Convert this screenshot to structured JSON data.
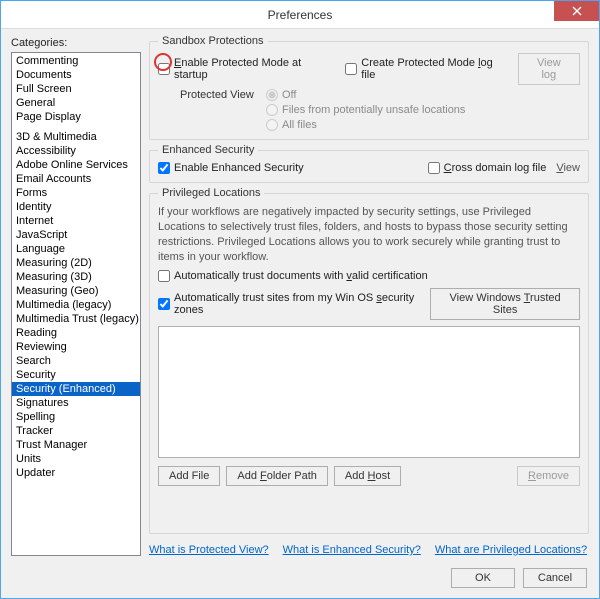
{
  "title": "Preferences",
  "categories_label": "Categories:",
  "categories_a": [
    "Commenting",
    "Documents",
    "Full Screen",
    "General",
    "Page Display"
  ],
  "categories_b": [
    "3D & Multimedia",
    "Accessibility",
    "Adobe Online Services",
    "Email Accounts",
    "Forms",
    "Identity",
    "Internet",
    "JavaScript",
    "Language",
    "Measuring (2D)",
    "Measuring (3D)",
    "Measuring (Geo)",
    "Multimedia (legacy)",
    "Multimedia Trust (legacy)",
    "Reading",
    "Reviewing",
    "Search",
    "Security",
    "Security (Enhanced)",
    "Signatures",
    "Spelling",
    "Tracker",
    "Trust Manager",
    "Units",
    "Updater"
  ],
  "selected_category": "Security (Enhanced)",
  "sandbox": {
    "legend": "Sandbox Protections",
    "enable_protected_pre": "",
    "enable_protected_u": "E",
    "enable_protected_post": "nable Protected Mode at startup",
    "create_log": "Create Protected Mode ",
    "create_log_u": "l",
    "create_log_post": "og file",
    "view_log": "View lo",
    "view_log_u": "g",
    "protected_view": "Protected View",
    "opt_off": "Off",
    "opt_unsafe": "Files from potentially unsafe locations",
    "opt_all": "All files"
  },
  "enhanced": {
    "legend": "Enhanced Security",
    "enable": "Enable Enhanced Security",
    "cross_u": "C",
    "cross_post": "ross domain log file",
    "view_u": "V",
    "view_post": "iew"
  },
  "priv": {
    "legend": "Privileged Locations",
    "help": "If your workflows are negatively impacted by security settings, use Privileged Locations to selectively trust files, folders, and hosts to bypass those security setting restrictions. Privileged Locations allows you to work securely while granting trust to items in your workflow.",
    "auto_valid_pre": "Automatically trust documents with ",
    "auto_valid_u": "v",
    "auto_valid_post": "alid certification",
    "auto_zones_pre": "Automatically trust sites from my Win OS ",
    "auto_zones_u": "s",
    "auto_zones_post": "ecurity zones",
    "view_trusted_pre": "View Windows ",
    "view_trusted_u": "T",
    "view_trusted_post": "rusted Sites",
    "add_file": "Add File",
    "add_folder_u": "F",
    "add_folder_pre": "Add ",
    "add_folder_post": "older Path",
    "add_host_pre": "Add ",
    "add_host_u": "H",
    "add_host_post": "ost",
    "remove_u": "R",
    "remove_post": "emove"
  },
  "links": {
    "a": "What is Protected View?",
    "b": "What is Enhanced Security?",
    "c": "What are Privileged Locations?"
  },
  "buttons": {
    "ok": "OK",
    "cancel": "Cancel"
  }
}
